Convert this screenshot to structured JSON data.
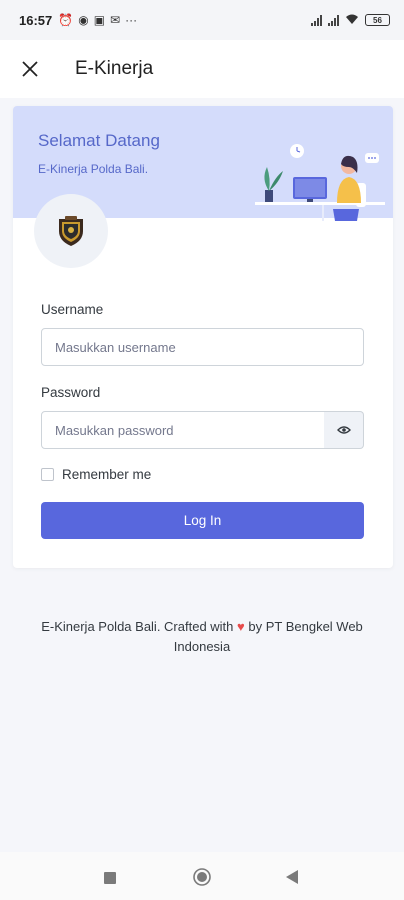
{
  "status_bar": {
    "time": "16:57",
    "battery": "56"
  },
  "app_bar": {
    "title": "E-Kinerja"
  },
  "banner": {
    "title": "Selamat Datang",
    "subtitle": "E-Kinerja Polda Bali."
  },
  "form": {
    "username_label": "Username",
    "username_placeholder": "Masukkan username",
    "password_label": "Password",
    "password_placeholder": "Masukkan password",
    "remember_label": "Remember me",
    "login_label": "Log In"
  },
  "footer": {
    "text_before": "E-Kinerja Polda Bali. Crafted with",
    "text_after": "by PT Bengkel Web Indonesia"
  },
  "colors": {
    "primary": "#5867dd",
    "banner_bg": "#d4dcfb",
    "heart": "#e74c4c"
  }
}
